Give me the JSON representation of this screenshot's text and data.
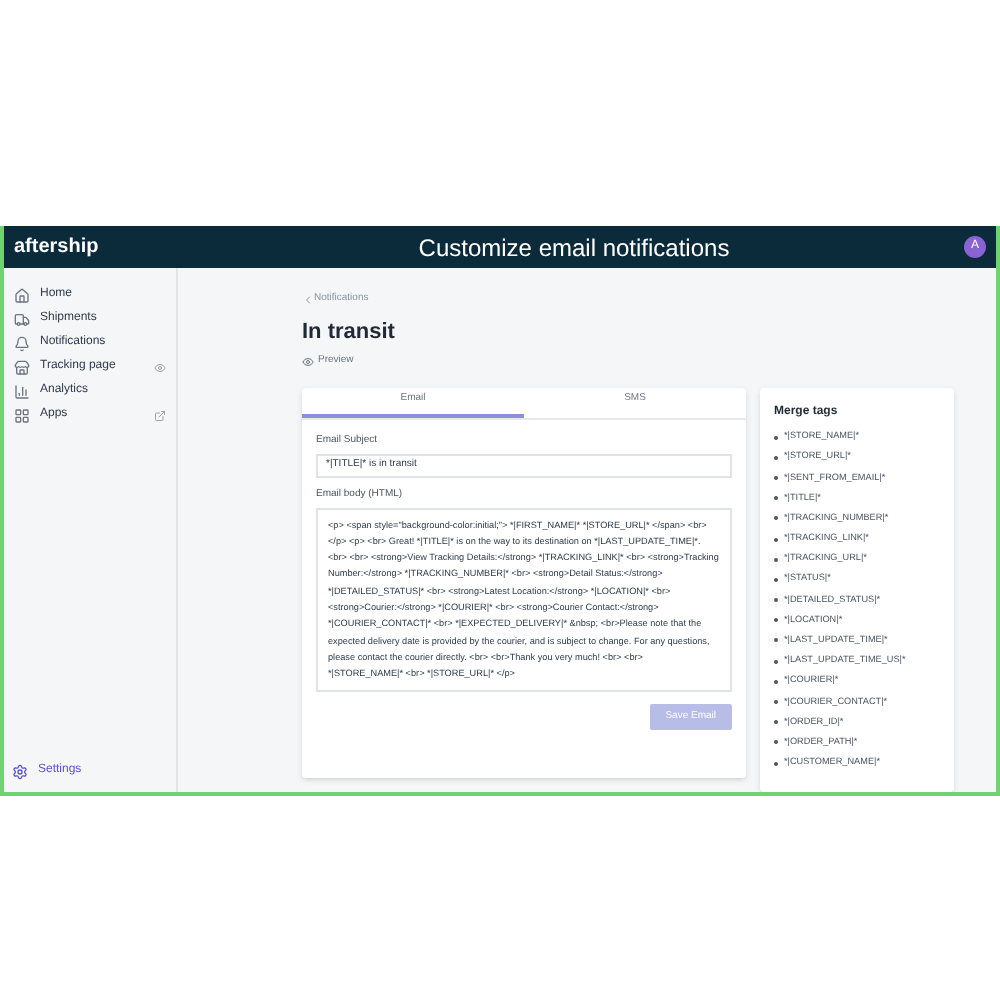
{
  "header": {
    "logo": "aftership",
    "title": "Customize email notifications",
    "avatar": "A"
  },
  "sidebar": {
    "items": [
      {
        "label": "Home"
      },
      {
        "label": "Shipments"
      },
      {
        "label": "Notifications"
      },
      {
        "label": "Tracking page"
      },
      {
        "label": "Analytics"
      },
      {
        "label": "Apps"
      }
    ],
    "settings": "Settings"
  },
  "breadcrumb": "Notifications",
  "page_title": "In transit",
  "preview": "Preview",
  "tabs": [
    {
      "label": "Email",
      "selected": true
    },
    {
      "label": "SMS",
      "selected": false
    }
  ],
  "subject": {
    "label": "Email Subject",
    "value": "*|TITLE|* is in transit"
  },
  "body": {
    "label": "Email body (HTML)",
    "value": "<p> <span style=\"background-color:initial;\"> *|FIRST_NAME|* *|STORE_URL|* </span> <br> </p> <p> <br> Great! *|TITLE|* is on the way to its destination on *|LAST_UPDATE_TIME|*. <br> <br> <strong>View Tracking Details:</strong> *|TRACKING_LINK|* <br> <strong>Tracking Number:</strong> *|TRACKING_NUMBER|* <br> <strong>Detail Status:</strong> *|DETAILED_STATUS|* <br> <strong>Latest Location:</strong> *|LOCATION|* <br> <strong>Courier:</strong> *|COURIER|* <br> <strong>Courier Contact:</strong> *|COURIER_CONTACT|* <br> *|EXPECTED_DELIVERY|* &nbsp; <br>Please note that the expected delivery date is provided by the courier, and is subject to change. For any questions, please contact the courier directly. <br> <br>Thank you very much! <br> <br> *|STORE_NAME|* <br> *|STORE_URL|* </p>"
  },
  "save_button": {
    "label": "Save Email",
    "disabled": true
  },
  "merge_tags": {
    "title": "Merge tags",
    "items": [
      "*|STORE_NAME|*",
      "*|STORE_URL|*",
      "*|SENT_FROM_EMAIL|*",
      "*|TITLE|*",
      "*|TRACKING_NUMBER|*",
      "*|TRACKING_LINK|*",
      "*|TRACKING_URL|*",
      "*|STATUS|*",
      "*|DETAILED_STATUS|*",
      "*|LOCATION|*",
      "*|LAST_UPDATE_TIME|*",
      "*|LAST_UPDATE_TIME_US|*",
      "*|COURIER|*",
      "*|COURIER_CONTACT|*",
      "*|ORDER_ID|*",
      "*|ORDER_PATH|*",
      "*|CUSTOMER_NAME|*"
    ]
  }
}
